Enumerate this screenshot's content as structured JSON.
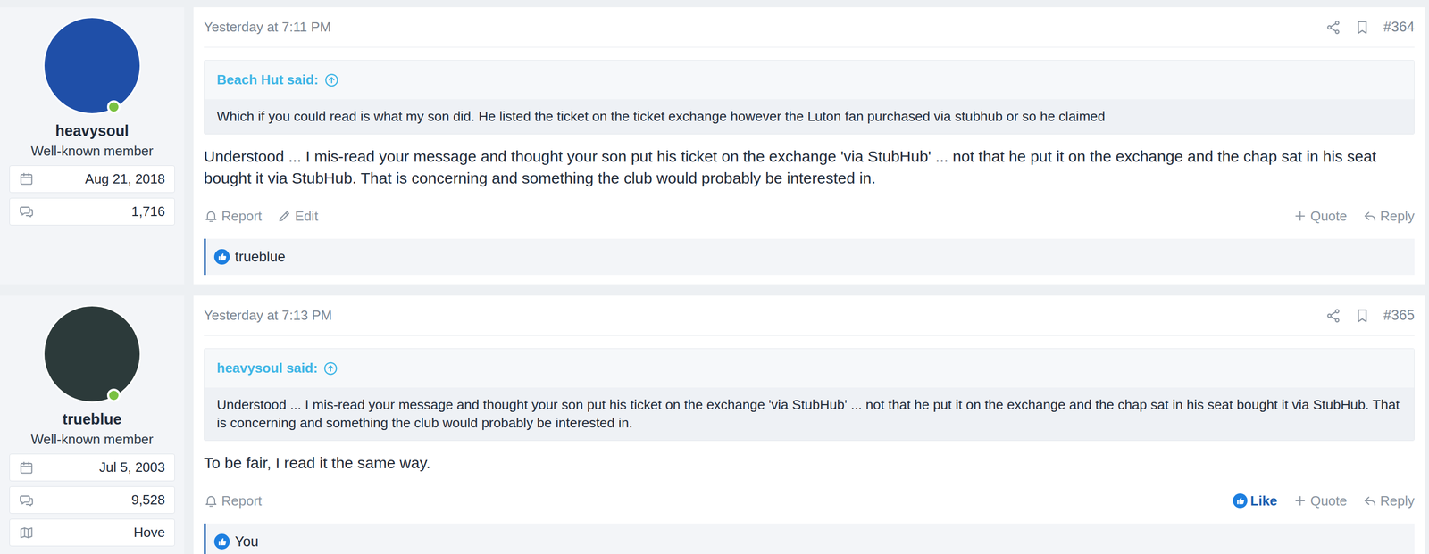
{
  "posts": [
    {
      "author": {
        "name": "heavysoul",
        "title": "Well-known member",
        "joined": "Aug 21, 2018",
        "messages": "1,716",
        "location": "",
        "online": true,
        "avatar_color": "#1f4fa8"
      },
      "time": "Yesterday at 7:11 PM",
      "number": "#364",
      "quote": {
        "author": "Beach Hut said:",
        "text": "Which if you could read is what my son did. He listed the ticket on the ticket exchange however the Luton fan purchased via stubhub or so he claimed"
      },
      "body": "Understood ... I mis-read your message and thought your son put his ticket on the exchange 'via StubHub' ... not that he put it on the exchange and the chap sat in his seat bought it via StubHub. That is concerning and something the club would probably be interested in.",
      "actions_left": [
        {
          "label": "Report",
          "kind": "report",
          "selected": false
        },
        {
          "label": "Edit",
          "kind": "edit",
          "selected": false
        }
      ],
      "actions_right": [
        {
          "label": "Quote",
          "kind": "quote",
          "selected": false
        },
        {
          "label": "Reply",
          "kind": "reply",
          "selected": false
        }
      ],
      "reactions": "trueblue"
    },
    {
      "author": {
        "name": "trueblue",
        "title": "Well-known member",
        "joined": "Jul 5, 2003",
        "messages": "9,528",
        "location": "Hove",
        "online": true,
        "avatar_color": "#2c3a3a"
      },
      "time": "Yesterday at 7:13 PM",
      "number": "#365",
      "quote": {
        "author": "heavysoul said:",
        "text": "Understood ... I mis-read your message and thought your son put his ticket on the exchange 'via StubHub' ... not that he put it on the exchange and the chap sat in his seat bought it via StubHub. That is concerning and something the club would probably be interested in."
      },
      "body": "To be fair, I read it the same way.",
      "actions_left": [
        {
          "label": "Report",
          "kind": "report",
          "selected": false
        }
      ],
      "actions_right": [
        {
          "label": "Like",
          "kind": "like",
          "selected": true
        },
        {
          "label": "Quote",
          "kind": "quote",
          "selected": false
        },
        {
          "label": "Reply",
          "kind": "reply",
          "selected": false
        }
      ],
      "reactions": "You"
    }
  ]
}
